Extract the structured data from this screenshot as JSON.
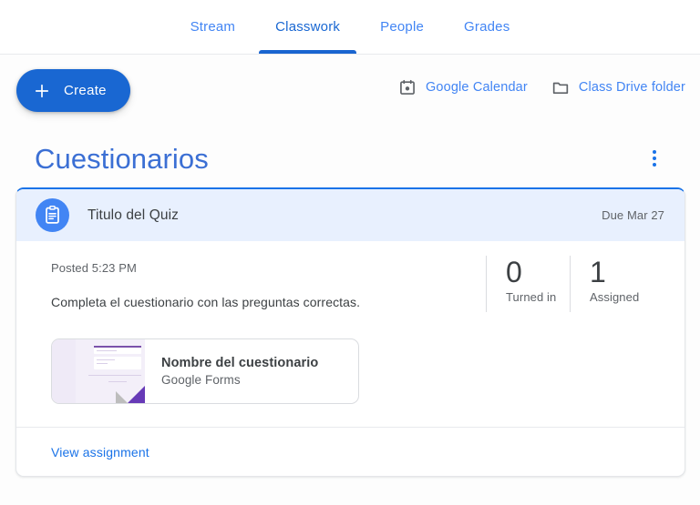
{
  "tabs": [
    {
      "label": "Stream",
      "active": false
    },
    {
      "label": "Classwork",
      "active": true
    },
    {
      "label": "People",
      "active": false
    },
    {
      "label": "Grades",
      "active": false
    }
  ],
  "toolbar": {
    "create_label": "Create",
    "plus_icon": "plus-icon",
    "links": [
      {
        "label": "Google Calendar",
        "icon": "calendar-icon"
      },
      {
        "label": "Class Drive folder",
        "icon": "folder-icon"
      }
    ]
  },
  "topic": {
    "title": "Cuestionarios",
    "menu_icon": "more-vert-icon"
  },
  "assignment": {
    "icon": "assignment-quiz-icon",
    "title": "Titulo del Quiz",
    "due": "Due Mar 27",
    "posted": "Posted 5:23 PM",
    "description": "Completa el cuestionario con las preguntas correctas.",
    "counters": [
      {
        "value": "0",
        "label": "Turned in"
      },
      {
        "value": "1",
        "label": "Assigned"
      }
    ],
    "attachment": {
      "title": "Nombre del cuestionario",
      "subtitle": "Google Forms",
      "thumb_icon": "google-forms-thumbnail"
    },
    "view_link": "View assignment"
  },
  "colors": {
    "accent_blue": "#1a73e8",
    "tab_blue": "#4285f4",
    "active_underline": "#1a65d0",
    "header_band": "#e8f0fe",
    "forms_purple": "#673ab7",
    "text_primary": "#3c4043",
    "text_secondary": "#5f6368"
  }
}
